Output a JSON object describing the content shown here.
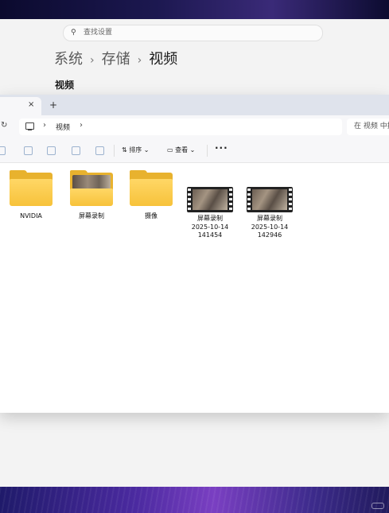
{
  "settings": {
    "search_placeholder": "查找设置",
    "breadcrumb": [
      "系统",
      "存储",
      "视频"
    ],
    "section_title": "视频"
  },
  "explorer": {
    "tab_close": "×",
    "tab_new": "+",
    "address": {
      "path_label": "视频",
      "chevron": "›"
    },
    "search_placeholder": "在 视频 中搜索",
    "commands": {
      "sort_label": "排序",
      "view_label": "查看",
      "more_label": "···"
    },
    "items": [
      {
        "name": "NVIDIA",
        "kind": "folder"
      },
      {
        "name": "屏幕录制",
        "kind": "folder-thumb"
      },
      {
        "name": "摄像",
        "kind": "folder"
      },
      {
        "name": "屏幕录制\n2025-10-14\n141454",
        "kind": "video"
      },
      {
        "name": "屏幕录制\n2025-10-14\n142946",
        "kind": "video"
      }
    ]
  },
  "colors": {
    "folder": "#f7c23a",
    "accent": "#0067c0",
    "wallpaper": "#4b2aa0"
  }
}
